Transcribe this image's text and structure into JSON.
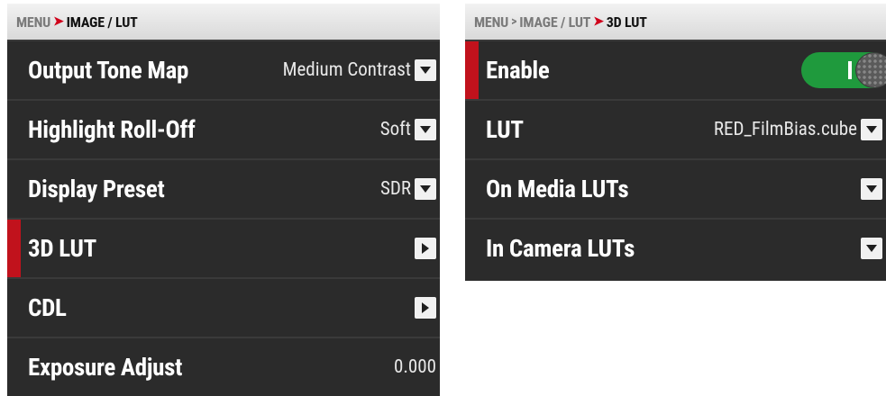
{
  "left_panel": {
    "breadcrumb": {
      "root": "MENU",
      "current": "IMAGE / LUT"
    },
    "rows": [
      {
        "label": "Output Tone Map",
        "value": "Medium Contrast",
        "control": "dropdown"
      },
      {
        "label": "Highlight Roll-Off",
        "value": "Soft",
        "control": "dropdown"
      },
      {
        "label": "Display Preset",
        "value": "SDR",
        "control": "dropdown"
      },
      {
        "label": "3D LUT",
        "value": "",
        "control": "submenu",
        "selected": true
      },
      {
        "label": "CDL",
        "value": "",
        "control": "submenu"
      },
      {
        "label": "Exposure Adjust",
        "value": "0.000",
        "control": "value"
      }
    ]
  },
  "right_panel": {
    "breadcrumb": {
      "root": "MENU",
      "mid": "IMAGE / LUT",
      "current": "3D LUT"
    },
    "rows": [
      {
        "label": "Enable",
        "control": "toggle",
        "state": "on",
        "selected": true
      },
      {
        "label": "LUT",
        "value": "RED_FilmBias.cube",
        "control": "dropdown"
      },
      {
        "label": "On Media LUTs",
        "value": "",
        "control": "dropdown"
      },
      {
        "label": "In Camera LUTs",
        "value": "",
        "control": "dropdown"
      }
    ]
  },
  "colors": {
    "panel_bg": "#2b2b2b",
    "selection_marker": "#c1121c",
    "toggle_on": "#1f9a3d",
    "breadcrumb_arrow": "#d0021b"
  },
  "icons": {
    "dropdown": "chevron-down-icon",
    "submenu": "chevron-right-icon"
  }
}
